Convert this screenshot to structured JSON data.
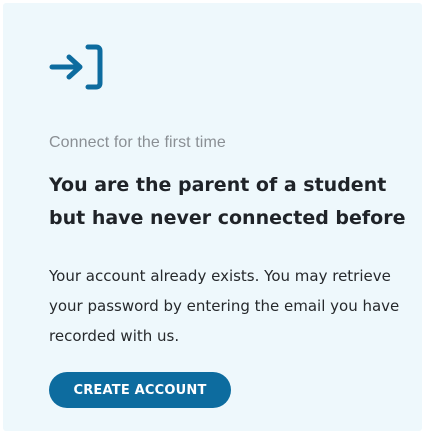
{
  "card": {
    "icon": "login-arrow-icon",
    "eyebrow": "Connect for the first time",
    "title": "You are the parent of a student but have never connected before",
    "body": "Your account already exists. You may retrieve your password by entering the email you have recorded with us.",
    "cta_label": "CREATE ACCOUNT"
  },
  "colors": {
    "card_background": "#eef8fc",
    "accent": "#0d6c9f",
    "eyebrow_text": "#8a8f94",
    "title_text": "#1f2328"
  }
}
